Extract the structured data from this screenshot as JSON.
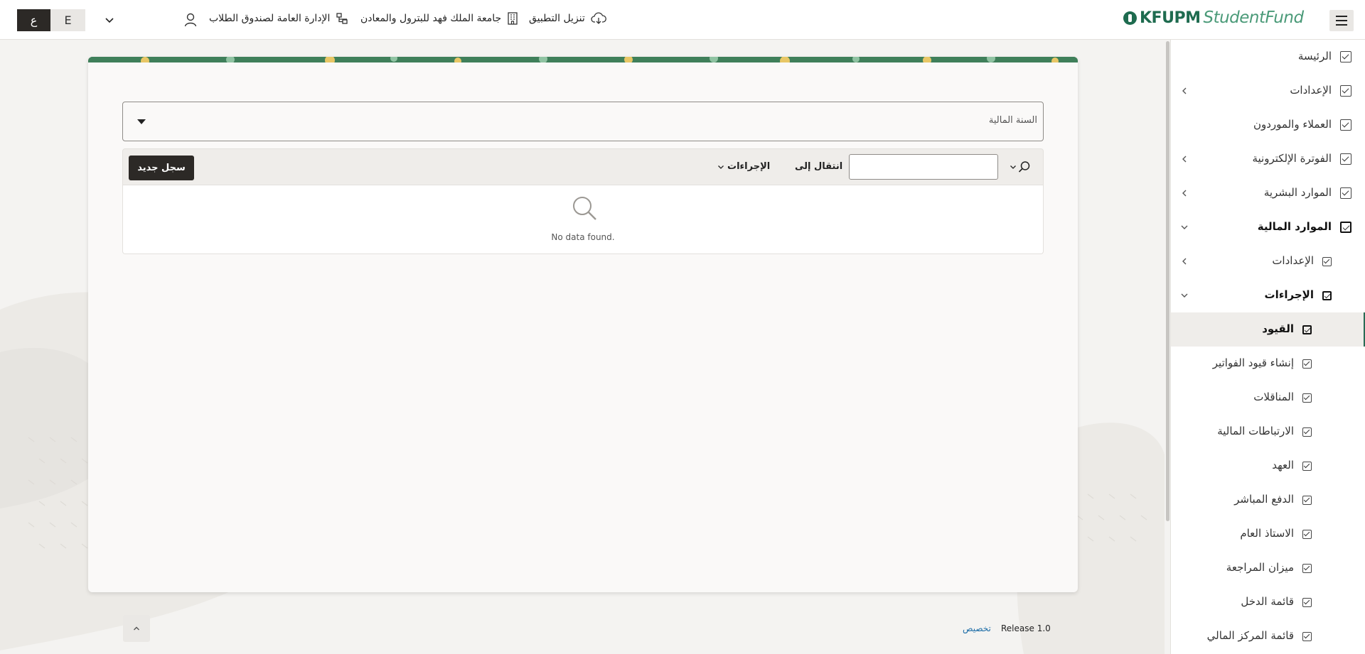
{
  "header": {
    "lang_en": "E",
    "lang_ar": "ع",
    "user_dept": "الإدارة العامة لصندوق الطلاب",
    "university": "جامعة الملك فهد للبترول والمعادن",
    "download_app": "تنزيل التطبيق",
    "logo_bold": "KFUPM",
    "logo_light": "StudentFund"
  },
  "main": {
    "fiscal_year_label": "السنة المالية",
    "goto_label": "انتقال إلى",
    "actions_label": "الإجراءات",
    "new_record_label": "سجل جديد",
    "no_data": "No data found."
  },
  "footer": {
    "customize": "تخصيص",
    "release": "Release 1.0"
  },
  "sidebar": {
    "items": [
      {
        "label": "الرئيسة",
        "level": 0,
        "arrow": "none",
        "bold": false
      },
      {
        "label": "الإعدادات",
        "level": 0,
        "arrow": "left",
        "bold": false
      },
      {
        "label": "العملاء والموردون",
        "level": 0,
        "arrow": "none",
        "bold": false
      },
      {
        "label": "الفوترة الإلكترونية",
        "level": 0,
        "arrow": "left",
        "bold": false
      },
      {
        "label": "الموارد البشرية",
        "level": 0,
        "arrow": "left",
        "bold": false
      },
      {
        "label": "الموارد المالية",
        "level": 0,
        "arrow": "down",
        "bold": true
      },
      {
        "label": "الإعدادات",
        "level": 1,
        "arrow": "left",
        "bold": false
      },
      {
        "label": "الإجراءات",
        "level": 1,
        "arrow": "down",
        "bold": true
      },
      {
        "label": "القيود",
        "level": 2,
        "arrow": "none",
        "bold": true,
        "active": true
      },
      {
        "label": "إنشاء قيود الفواتير",
        "level": 2,
        "arrow": "none",
        "bold": false
      },
      {
        "label": "المناقلات",
        "level": 2,
        "arrow": "none",
        "bold": false
      },
      {
        "label": "الارتباطات المالية",
        "level": 2,
        "arrow": "none",
        "bold": false
      },
      {
        "label": "العهد",
        "level": 2,
        "arrow": "none",
        "bold": false
      },
      {
        "label": "الدفع المباشر",
        "level": 2,
        "arrow": "none",
        "bold": false
      },
      {
        "label": "الاستاذ العام",
        "level": 2,
        "arrow": "none",
        "bold": false
      },
      {
        "label": "ميزان المراجعة",
        "level": 2,
        "arrow": "none",
        "bold": false
      },
      {
        "label": "قائمة الدخل",
        "level": 2,
        "arrow": "none",
        "bold": false
      },
      {
        "label": "قائمة المركز المالي",
        "level": 2,
        "arrow": "none",
        "bold": false
      }
    ]
  },
  "colors": {
    "brand_green": "#1e6b4f",
    "dark_button": "#2c2926",
    "link_blue": "#1e6ea8"
  }
}
